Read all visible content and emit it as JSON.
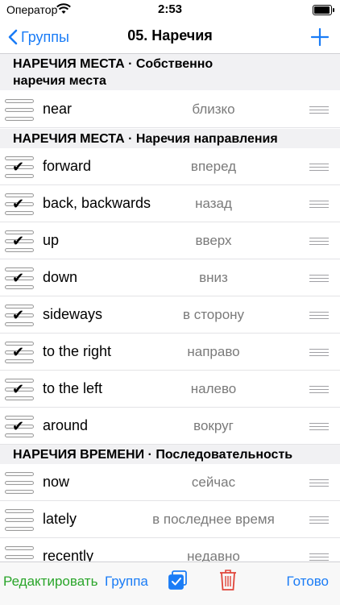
{
  "status": {
    "carrier": "Оператор",
    "time": "2:53"
  },
  "nav": {
    "back_label": "Группы",
    "title": "05. Наречия"
  },
  "sections": [
    {
      "title_line1": "НАРЕЧИЯ МЕСТА · Собственно",
      "title_line2": "наречия места",
      "rows": [
        {
          "en": "near",
          "ru": "близко",
          "checked": false
        }
      ]
    },
    {
      "title_line1": "НАРЕЧИЯ МЕСТА · Наречия направления",
      "rows": [
        {
          "en": "forward",
          "ru": "вперед",
          "checked": true
        },
        {
          "en": "back, backwards",
          "ru": "назад",
          "checked": true
        },
        {
          "en": "up",
          "ru": "вверх",
          "checked": true
        },
        {
          "en": "down",
          "ru": "вниз",
          "checked": true
        },
        {
          "en": "sideways",
          "ru": "в сторону",
          "checked": true
        },
        {
          "en": "to the right",
          "ru": "направо",
          "checked": true
        },
        {
          "en": "to the left",
          "ru": "налево",
          "checked": true
        },
        {
          "en": "around",
          "ru": "вокруг",
          "checked": true
        }
      ]
    },
    {
      "title_line1": "НАРЕЧИЯ ВРЕМЕНИ · Последовательность",
      "rows": [
        {
          "en": "now",
          "ru": "сейчас",
          "checked": false
        },
        {
          "en": "lately",
          "ru": "в последнее время",
          "checked": false
        },
        {
          "en": "recently",
          "ru": "недавно",
          "checked": false
        }
      ]
    }
  ],
  "toolbar": {
    "edit_label": "Редактировать",
    "group_label": "Группа",
    "done_label": "Готово"
  },
  "colors": {
    "accent": "#1a7cf6",
    "edit": "#2aa52a",
    "trash": "#e0453a"
  },
  "icons": {
    "back": "chevron-left-icon",
    "add": "plus-icon",
    "copy": "copy-checklist-icon",
    "delete": "trash-icon",
    "reorder": "reorder-grip-icon",
    "check": "checkmark-icon"
  }
}
